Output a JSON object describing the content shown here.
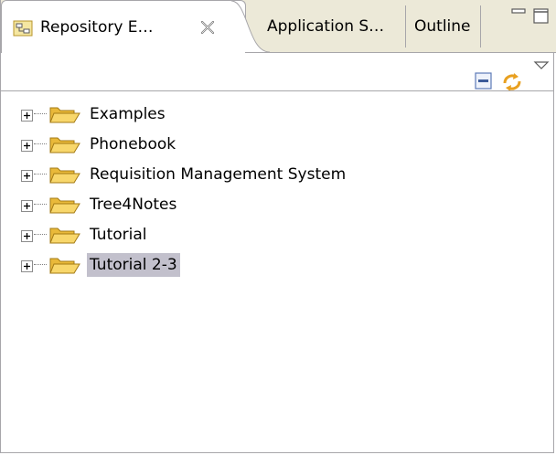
{
  "tabs": [
    {
      "label": "Repository E…",
      "icon": "repository-icon",
      "active": true,
      "closable": true
    },
    {
      "label": "Application S…",
      "active": false
    },
    {
      "label": "Outline",
      "active": false
    }
  ],
  "window_controls": {
    "minimize": "minimize-icon",
    "maximize": "maximize-icon"
  },
  "toolbar": {
    "buttons": [
      {
        "icon": "collapse-all-icon"
      },
      {
        "icon": "link-with-editor-icon"
      },
      {
        "icon": "view-menu-icon"
      }
    ]
  },
  "tree": {
    "items": [
      {
        "label": "Examples",
        "selected": false
      },
      {
        "label": "Phonebook",
        "selected": false
      },
      {
        "label": "Requisition Management System",
        "selected": false
      },
      {
        "label": "Tree4Notes",
        "selected": false
      },
      {
        "label": "Tutorial",
        "selected": false
      },
      {
        "label": "Tutorial 2-3",
        "selected": true
      }
    ]
  },
  "colors": {
    "tab_bg": "#ece9d8",
    "border": "#a7a6aa",
    "selection": "#c2c0cc",
    "folder": "#f2cd55"
  }
}
